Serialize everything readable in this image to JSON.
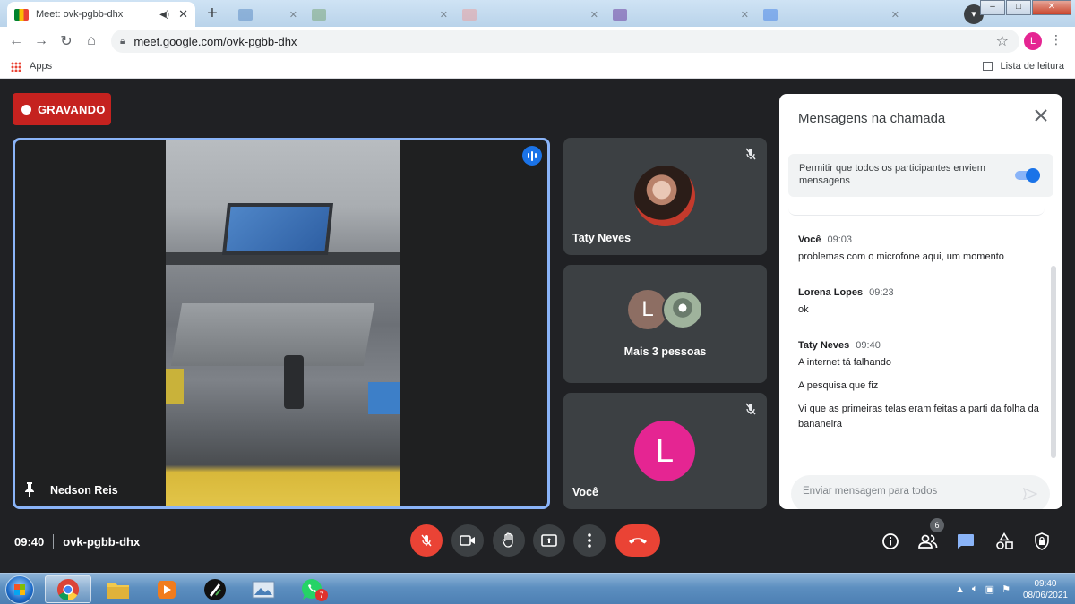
{
  "browser": {
    "active_tab": {
      "title": "Meet: ovk-pgbb-dhx"
    },
    "url": "meet.google.com/ovk-pgbb-dhx",
    "profile_initial": "L",
    "bookmarks": {
      "apps_label": "Apps",
      "reading_list_label": "Lista de leitura"
    }
  },
  "meet": {
    "recording_label": "GRAVANDO",
    "main_tile": {
      "name": "Nedson Reis"
    },
    "tiles": [
      {
        "name": "Taty Neves"
      },
      {
        "name": "Mais 3 pessoas",
        "initial": "L"
      },
      {
        "name": "Você",
        "initial": "L"
      }
    ],
    "chat": {
      "title": "Mensagens na chamada",
      "permission_text": "Permitir que todos os participantes enviem mensagens",
      "permission_enabled": true,
      "messages": [
        {
          "sender": "Você",
          "time": "09:03",
          "lines": [
            "problemas com o microfone aqui, um momento"
          ]
        },
        {
          "sender": "Lorena Lopes",
          "time": "09:23",
          "lines": [
            "ok"
          ]
        },
        {
          "sender": "Taty Neves",
          "time": "09:40",
          "lines": [
            "A internet tá falhando",
            "A pesquisa que fiz",
            "Vi que as primeiras telas eram feitas a parti da folha da bananeira"
          ]
        }
      ],
      "input_placeholder": "Enviar mensagem para todos"
    },
    "bottom": {
      "time": "09:40",
      "meeting_code": "ovk-pgbb-dhx",
      "participants_count": "6"
    }
  },
  "taskbar": {
    "whatsapp_badge": "7",
    "clock_time": "09:40",
    "clock_date": "08/06/2021"
  },
  "colors": {
    "recording": "#c5221f",
    "accent": "#1a73e8",
    "hangup": "#ea4335",
    "you_avatar": "#e52592",
    "lorena_avatar": "#8d6e63"
  }
}
